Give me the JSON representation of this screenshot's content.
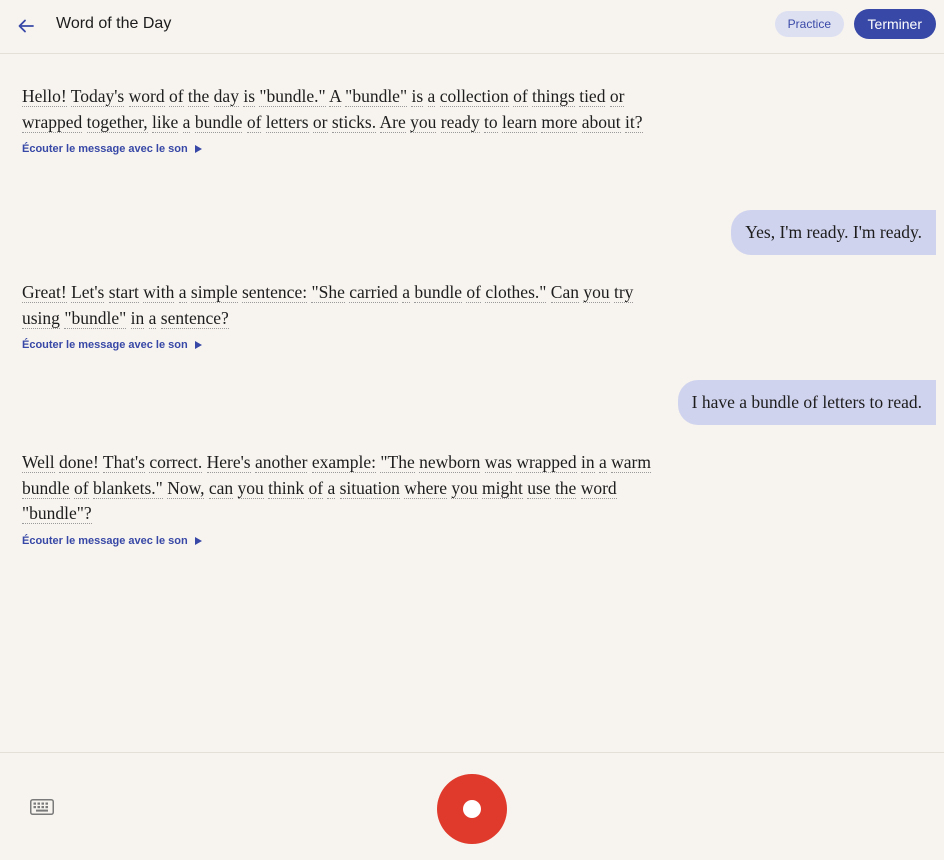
{
  "header": {
    "title": "Word of the Day",
    "practice_label": "Practice",
    "finish_label": "Terminer"
  },
  "messages": [
    {
      "role": "assistant",
      "text": "Hello! Today's word of the day is \"bundle.\" A \"bundle\" is a collection of things tied or wrapped together, like a bundle of letters or sticks. Are you ready to learn more about it?",
      "listen_label": "Écouter le message avec le son"
    },
    {
      "role": "user",
      "text": "Yes, I'm ready. I'm ready."
    },
    {
      "role": "assistant",
      "text": "Great! Let's start with a simple sentence: \"She carried a bundle of clothes.\" Can you try using \"bundle\" in a sentence?",
      "listen_label": "Écouter le message avec le son"
    },
    {
      "role": "user",
      "text": "I have a bundle of letters to read."
    },
    {
      "role": "assistant",
      "text": "Well done! That's correct. Here's another example: \"The newborn was wrapped in a warm bundle of blankets.\" Now, can you think of a situation where you might use the word \"bundle\"?",
      "listen_label": "Écouter le message avec le son"
    }
  ],
  "icons": {
    "back": "arrow-left-icon",
    "play": "play-icon",
    "keyboard": "keyboard-icon",
    "record": "record-icon"
  },
  "colors": {
    "background": "#f7f4ef",
    "accent": "#3848a6",
    "user_bubble": "#d0d3ee",
    "record": "#e03a2c"
  }
}
